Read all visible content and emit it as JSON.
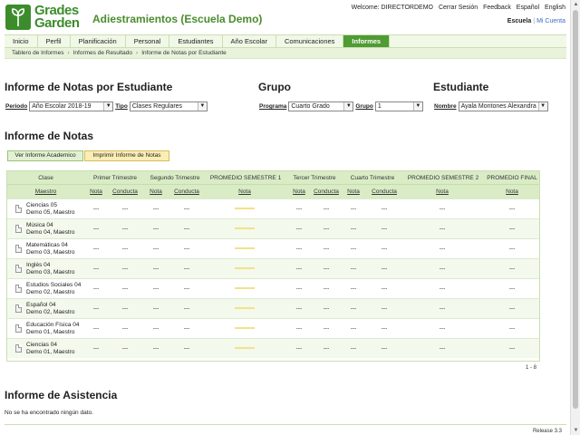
{
  "brand": {
    "line1": "Grades",
    "line2": "Garden",
    "accent": "#3d8c2c"
  },
  "app_title": "Adiestramientos (Escuela Demo)",
  "topnav": {
    "welcome": "Welcome: DIRECTORDEMO",
    "logout": "Cerrar Sesión",
    "feedback": "Feedback",
    "spanish": "Español",
    "english": "English"
  },
  "subnav": {
    "school": "Escuela",
    "account": "Mi Cuenta"
  },
  "menu": [
    "Inicio",
    "Perfil",
    "Planificación",
    "Personal",
    "Estudiantes",
    "Año Escolar",
    "Comunicaciones",
    "Informes"
  ],
  "menu_active": "Informes",
  "breadcrumb": [
    "Tablero de Informes",
    "Informes de Resultado",
    "Informe de Notas por Estudiante"
  ],
  "filters": {
    "title": "Informe de Notas por Estudiante",
    "periodo_label": "Periodo",
    "periodo_value": "Año Escolar 2018-19",
    "tipo_label": "Tipo",
    "tipo_value": "Clases Regulares"
  },
  "grupo": {
    "title": "Grupo",
    "programa_label": "Programa",
    "programa_value": "Cuarto Grado",
    "grupo_label": "Grupo",
    "grupo_value": "1"
  },
  "estudiante": {
    "title": "Estudiante",
    "nombre_label": "Nombre",
    "nombre_value": "Ayala Montones Alexandra"
  },
  "notas": {
    "title": "Informe de Notas",
    "btn_academic": "Ver Informe Academico",
    "btn_print": "Imprimir Informe de Notas"
  },
  "table": {
    "h_clase": "Clase",
    "h_maestro": "Maestro",
    "h_t1": "Primer Trimestre",
    "h_t2": "Segundo Trimestre",
    "h_s1": "PROMEDIO SEMESTRE 1",
    "h_t3": "Tercer Trimestre",
    "h_t4": "Cuarto Trimestre",
    "h_s2": "PROMEDIO SEMESTRE 2",
    "h_final": "PROMEDIO FINAL",
    "h_nota": "Nota",
    "h_conducta": "Conducta",
    "empty": "---",
    "rows": [
      {
        "clase": "Ciencias 05",
        "maestro": "Demo 05, Maestro"
      },
      {
        "clase": "Música 04",
        "maestro": "Demo 04, Maestro"
      },
      {
        "clase": "Matemáticas 04",
        "maestro": "Demo 03, Maestro"
      },
      {
        "clase": "Inglés 04",
        "maestro": "Demo 03, Maestro"
      },
      {
        "clase": "Estudios Sociales 04",
        "maestro": "Demo 02, Maestro"
      },
      {
        "clase": "Español 04",
        "maestro": "Demo 02, Maestro"
      },
      {
        "clase": "Educación Física 04",
        "maestro": "Demo 01, Maestro"
      },
      {
        "clase": "Ciencias 04",
        "maestro": "Demo 01, Maestro"
      }
    ],
    "pager": "1 - 8"
  },
  "asistencia": {
    "title": "Informe de Asistencia",
    "empty": "No se ha encontrado ningún dato."
  },
  "release": "Release 3.3"
}
